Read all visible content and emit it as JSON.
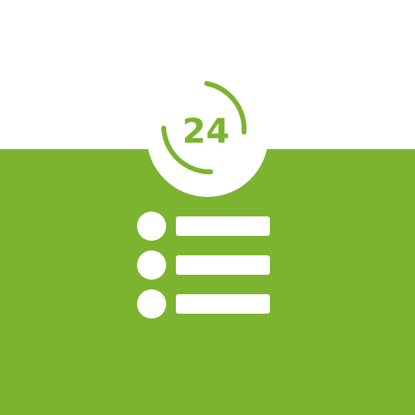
{
  "icon": {
    "badge_text": "24",
    "list_item_count": 3
  },
  "colors": {
    "background": "#ffffff",
    "brand_green": "#7cb32f",
    "foreground": "#ffffff"
  },
  "icons": [
    "24-hour-clock-icon",
    "list-icon"
  ]
}
